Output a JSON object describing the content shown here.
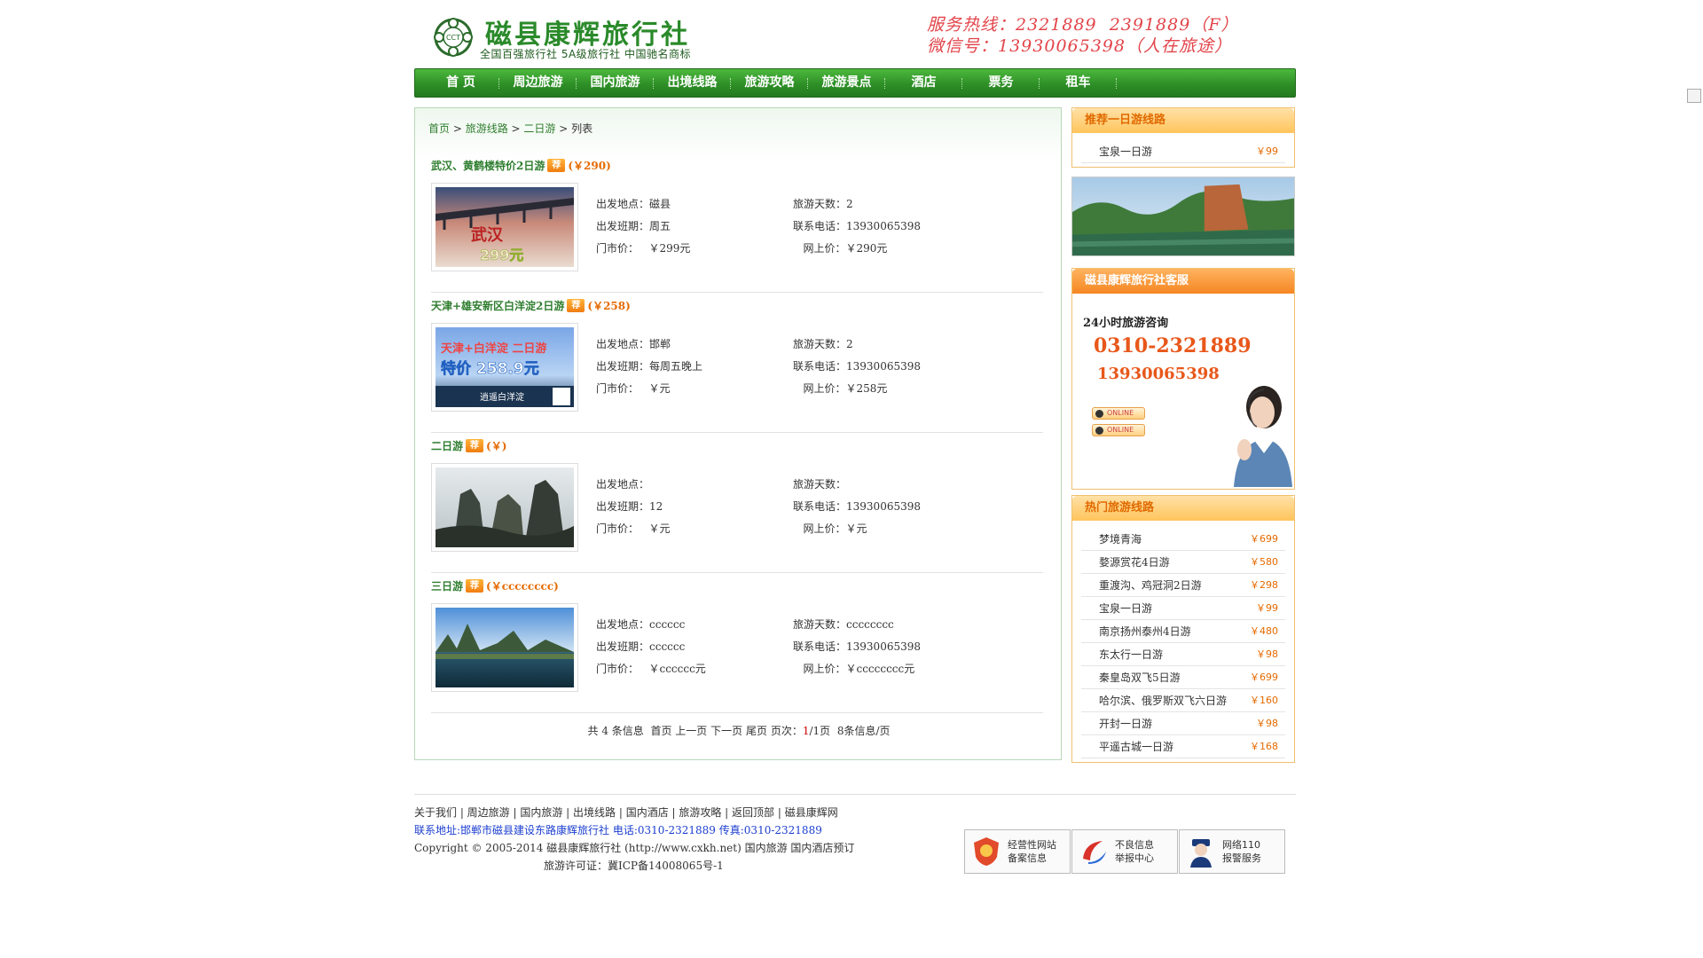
{
  "header": {
    "brand": "磁县康辉旅行社",
    "slogan": "全国百强旅行社  5A级旅行社  中国驰名商标",
    "logo_text": "CCT",
    "hotline_line1": "服务热线：2321889  2391889（F）",
    "hotline_line2": "微信号：13930065398（人在旅途）"
  },
  "nav": [
    "首 页",
    "周边旅游",
    "国内旅游",
    "出境线路",
    "旅游攻略",
    "旅游景点",
    "酒店",
    "票务",
    "租车"
  ],
  "breadcrumb": {
    "home": "首页",
    "sep1": " > ",
    "routes": "旅游线路",
    "sep2": " > ",
    "cat": "二日游",
    "sep3": " > ",
    "current": "列表"
  },
  "labels": {
    "depart": "出发地点：",
    "days": "旅游天数：",
    "schedule": "出发班期：",
    "phone": "联系电话：",
    "market": "门市价：",
    "online": "网上价：",
    "tag": "荐"
  },
  "items": [
    {
      "title": "武汉、黄鹤楼特价2日游",
      "price": "(￥290)",
      "depart": "磁县",
      "days": "2",
      "schedule": "周五",
      "phone": "13930065398",
      "market": "￥299元",
      "online": "￥290元"
    },
    {
      "title": "天津+雄安新区白洋淀2日游",
      "price": "(￥258)",
      "depart": "邯郸",
      "days": "2",
      "schedule": "每周五晚上",
      "phone": "13930065398",
      "market": "￥元",
      "online": "￥258元"
    },
    {
      "title": "二日游",
      "price": "(￥)",
      "depart": "",
      "days": "",
      "schedule": "12",
      "phone": "13930065398",
      "market": "￥元",
      "online": "￥元"
    },
    {
      "title": "三日游",
      "price": "(￥cccccccc)",
      "depart": "cccccc",
      "days": "cccccccc",
      "schedule": "cccccc",
      "phone": "13930065398",
      "market": "￥cccccc元",
      "online": "￥cccccccc元"
    }
  ],
  "item_image_text": {
    "img1_line1": "武汉",
    "img1_line2": "299元",
    "img2_line1": "天津+白洋淀 二日游",
    "img2_line2": "特价 258.9元",
    "img2_line3": "逍遥白洋淀"
  },
  "pager": {
    "prefix": "共",
    "count": "4",
    "suffix": "条信息",
    "first": "首页",
    "prev": "上一页",
    "next": "下一页",
    "last": "尾页",
    "pages_label": "页次：",
    "cur": "1",
    "total": "/1页",
    "per_page": "8条信息/页"
  },
  "recommend": {
    "title": "推荐一日游线路",
    "items": [
      {
        "name": "宝泉一日游",
        "price": "￥99"
      }
    ]
  },
  "service": {
    "title": "磁县康辉旅行社客服",
    "consult": "24小时旅游咨询",
    "tel1": "0310-2321889",
    "tel2": "13930065398",
    "qq_label": "ONLINE"
  },
  "hot": {
    "title": "热门旅游线路",
    "items": [
      {
        "name": "梦境青海",
        "price": "￥699"
      },
      {
        "name": "婺源赏花4日游",
        "price": "￥580"
      },
      {
        "name": "重渡沟、鸡冠洞2日游",
        "price": "￥298"
      },
      {
        "name": "宝泉一日游",
        "price": "￥99"
      },
      {
        "name": "南京扬州泰州4日游",
        "price": "￥480"
      },
      {
        "name": "东太行一日游",
        "price": "￥98"
      },
      {
        "name": "秦皇岛双飞5日游",
        "price": "￥699"
      },
      {
        "name": "哈尔滨、俄罗斯双飞六日游",
        "price": "￥160"
      },
      {
        "name": "开封一日游",
        "price": "￥98"
      },
      {
        "name": "平遥古城一日游",
        "price": "￥168"
      }
    ]
  },
  "footer": {
    "links": "关于我们 | 周边旅游 | 国内旅游 | 出境线路 | 国内酒店 | 旅游攻略 | 返回顶部 | 磁县康辉网",
    "contact": "联系地址:邯郸市磁县建设东路康辉旅行社 电话:0310-2321889 传真:0310-2321889",
    "copyright": "Copyright © 2005-2014 磁县康辉旅行社 (http://www.cxkh.net) 国内旅游 国内酒店预订",
    "license": "旅游许可证：冀ICP备14008065号-1",
    "badges": [
      {
        "line1": "经营性网站",
        "line2": "备案信息"
      },
      {
        "line1": "不良信息",
        "line2": "举报中心"
      },
      {
        "line1": "网络110",
        "line2": "报警服务"
      }
    ]
  },
  "colors": {
    "brand_green": "#2e8f27",
    "price_orange": "#e56a00",
    "hotline_red": "#e2444a"
  }
}
